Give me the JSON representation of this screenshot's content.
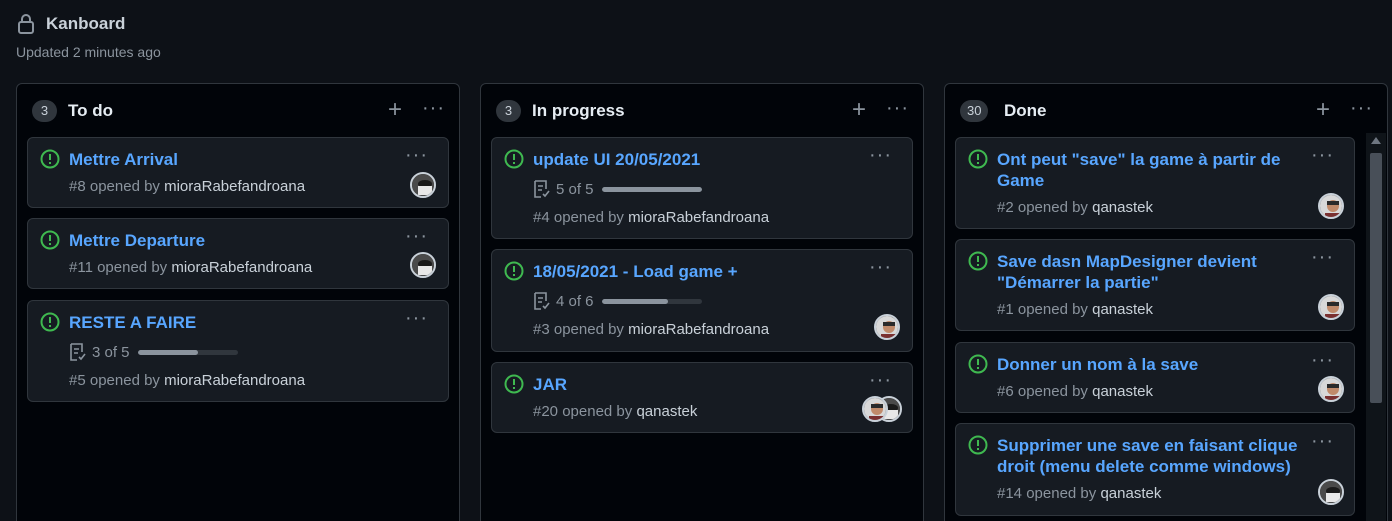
{
  "board": {
    "title": "Kanboard",
    "updated": "Updated 2 minutes ago"
  },
  "columns": [
    {
      "count": "3",
      "title": "To do",
      "cards": [
        {
          "title": "Mettre Arrival",
          "number": "#8",
          "opened_by": "opened by",
          "user": "mioraRabefandroana"
        },
        {
          "title": "Mettre Departure",
          "number": "#11",
          "opened_by": "opened by",
          "user": "mioraRabefandroana"
        },
        {
          "title": "RESTE A FAIRE",
          "tasks": "3 of 5",
          "progress": 0.6,
          "number": "#5",
          "opened_by": "opened by",
          "user": "mioraRabefandroana"
        }
      ]
    },
    {
      "count": "3",
      "title": "In progress",
      "cards": [
        {
          "title": "update UI 20/05/2021",
          "tasks": "5 of 5",
          "progress": 1.0,
          "number": "#4",
          "opened_by": "opened by",
          "user": "mioraRabefandroana"
        },
        {
          "title": "18/05/2021 - Load game +",
          "tasks": "4 of 6",
          "progress": 0.667,
          "number": "#3",
          "opened_by": "opened by",
          "user": "mioraRabefandroana"
        },
        {
          "title": "JAR",
          "number": "#20",
          "opened_by": "opened by",
          "user": "qanastek"
        }
      ]
    },
    {
      "count": "30",
      "title": "Done",
      "cards": [
        {
          "title_line1": "Ont peut \"save\" la game à partir de",
          "title_line2": "Game",
          "number": "#2",
          "opened_by": "opened by",
          "user": "qanastek"
        },
        {
          "title_line1": "Save dasn MapDesigner devient",
          "title_line2": "\"Démarrer la partie\"",
          "number": "#1",
          "opened_by": "opened by",
          "user": "qanastek"
        },
        {
          "title": "Donner un nom à la save",
          "number": "#6",
          "opened_by": "opened by",
          "user": "qanastek"
        },
        {
          "title_line1": "Supprimer une save en faisant clique",
          "title_line2": "droit (menu delete comme windows)",
          "number": "#14",
          "opened_by": "opened by",
          "user": "qanastek"
        }
      ]
    }
  ],
  "icons": {
    "lock": "lock-icon",
    "plus": "plus-icon",
    "more": "kebab-horizontal-icon",
    "issue": "issue-opened-icon",
    "tasklist": "checklist-icon"
  },
  "colors": {
    "background": "#0d1117",
    "card": "#161b22",
    "border": "#30363d",
    "link": "#58a6ff",
    "issue_open": "#3fb950",
    "muted": "#8b949e"
  }
}
